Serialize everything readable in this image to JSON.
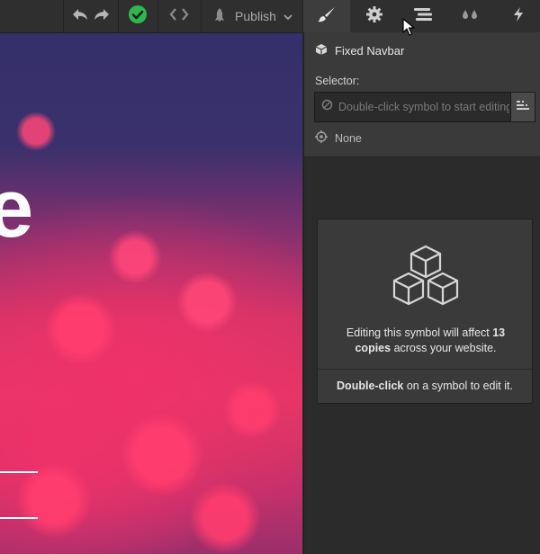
{
  "toolbar": {
    "publish_label": "Publish",
    "icons": [
      "undo-icon",
      "redo-icon",
      "checkmark-icon",
      "code-icon",
      "rocket-icon",
      "chevron-down-icon"
    ],
    "check_color": "#2db84d"
  },
  "panel_tabs": [
    {
      "name": "style-tab",
      "icon": "paintbrush-icon",
      "active": true
    },
    {
      "name": "settings-tab",
      "icon": "gear-icon",
      "active": false
    },
    {
      "name": "navigator-tab",
      "icon": "navigator-icon",
      "active": false
    },
    {
      "name": "swatches-tab",
      "icon": "drops-icon",
      "active": false
    },
    {
      "name": "interactions-tab",
      "icon": "lightning-icon",
      "active": false
    }
  ],
  "element": {
    "name": "Fixed Navbar",
    "icon": "symbol-cube-icon"
  },
  "selector": {
    "label": "Selector:",
    "placeholder": "Double-click symbol to start editing",
    "state_label": "None"
  },
  "symbol_card": {
    "message_prefix": "Editing this symbol will affect ",
    "copies_count": "13",
    "copies_word": "copies",
    "message_suffix": " across your website.",
    "hint_bold": "Double-click",
    "hint_rest": " on a symbol to edit it."
  },
  "canvas": {
    "hero_text": "e"
  }
}
